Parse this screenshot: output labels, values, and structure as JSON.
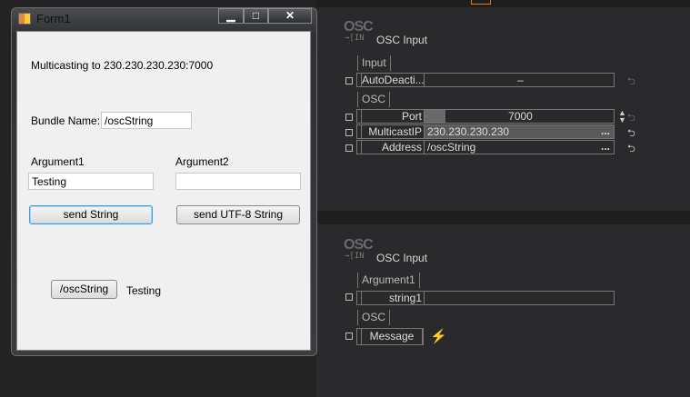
{
  "form": {
    "title": "Form1",
    "controls": {
      "minimize": "▁",
      "maximize": "□",
      "close": "✕"
    },
    "status": "Multicasting to 230.230.230.230:7000",
    "bundle_label": "Bundle Name:",
    "bundle_value": "/oscString",
    "arg1_label": "Argument1",
    "arg1_value": "Testing",
    "arg2_label": "Argument2",
    "arg2_value": "",
    "send_string": "send String",
    "send_utf8": "send UTF-8 String",
    "received_button": "/oscString",
    "received_value": "Testing"
  },
  "node1": {
    "logo": "OSC",
    "in_tag": "→[IN",
    "title": "OSC Input",
    "group_input": "Input",
    "auto_deactivate": {
      "name": "AutoDeacti...",
      "value": "–"
    },
    "group_osc": "OSC",
    "port": {
      "name": "Port",
      "value": "7000"
    },
    "multicast": {
      "name": "MulticastIP",
      "value": "230.230.230.230",
      "more": "..."
    },
    "address": {
      "name": "Address",
      "value": "/oscString",
      "more": "..."
    }
  },
  "node2": {
    "logo": "OSC",
    "in_tag": "→[IN",
    "title": "OSC Input",
    "group_arg": "Argument1",
    "string1": {
      "name": "string1",
      "value": ""
    },
    "group_osc": "OSC",
    "message": "Message"
  },
  "colors": {
    "accent": "#f07a1a",
    "bg": "#232323",
    "panel": "#2a2a2c"
  }
}
